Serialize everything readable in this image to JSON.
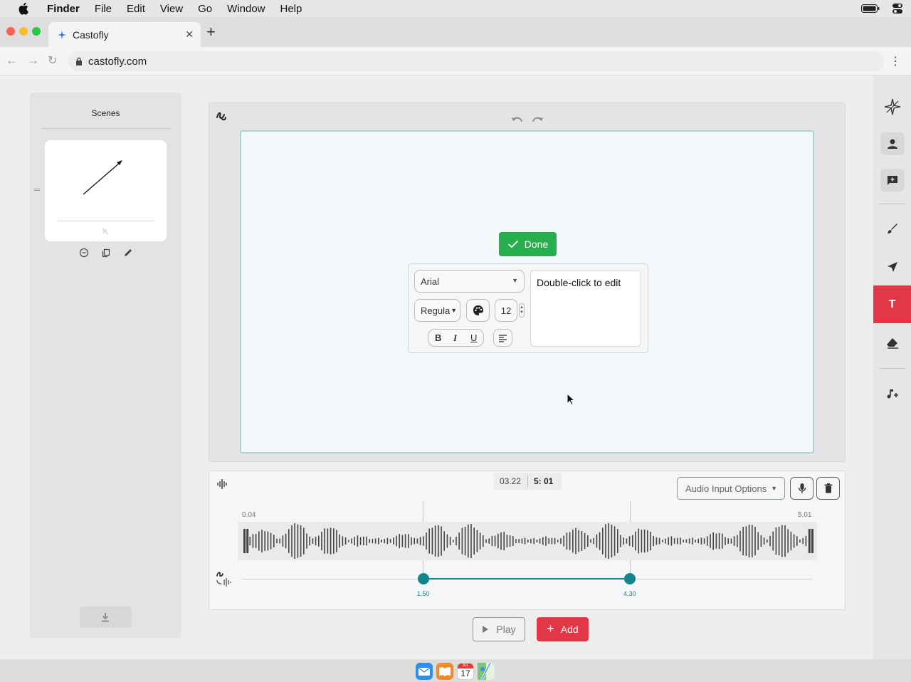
{
  "menubar": {
    "app_name": "Finder",
    "items": [
      "File",
      "Edit",
      "View",
      "Go",
      "Window",
      "Help"
    ]
  },
  "browser": {
    "tab_title": "Castofly",
    "url": "castofly.com"
  },
  "scenes": {
    "title": "Scenes"
  },
  "text_tool": {
    "done_label": "Done",
    "font_family": "Arial",
    "font_weight": "Regula",
    "font_size": "12",
    "bold_label": "B",
    "italic_label": "I",
    "underline_label": "U",
    "text_content": "Double-click to edit"
  },
  "audio": {
    "current_time": "03.22",
    "total_time": "5: 01",
    "input_options_label": "Audio Input Options",
    "waveform_start": "0.04",
    "waveform_end": "5.01",
    "trim_start": "1.50",
    "trim_end": "4.30"
  },
  "controls": {
    "play_label": "Play",
    "add_label": "Add"
  },
  "dock": {
    "calendar_month": "JUL",
    "calendar_day": "17"
  },
  "colors": {
    "accent_red": "#e13746",
    "done_green": "#27ae4f",
    "teal": "#11858a"
  }
}
